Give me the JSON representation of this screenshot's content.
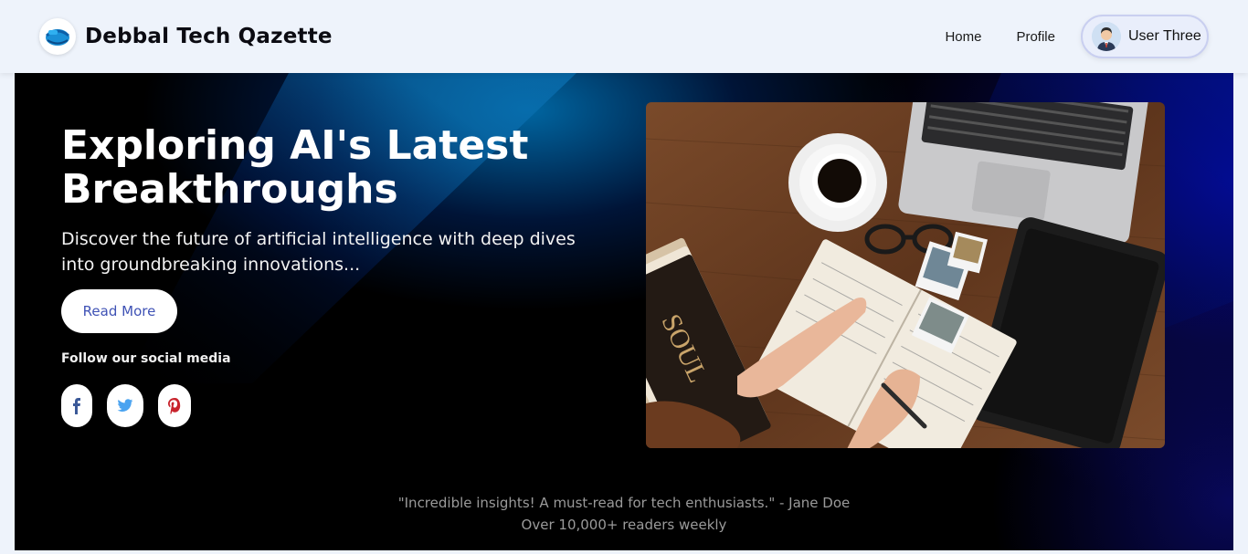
{
  "nav": {
    "brand": "Debbal Tech Qazette",
    "links": [
      {
        "label": "Home"
      },
      {
        "label": "Profile"
      }
    ],
    "user": {
      "name": "User Three"
    },
    "icons": {
      "logo": "globe-logo-icon",
      "avatar": "user-avatar-icon"
    }
  },
  "hero": {
    "title": "Exploring AI's Latest Breakthroughs",
    "subtitle": "Discover the future of artificial intelligence with deep dives into groundbreaking innovations...",
    "cta": "Read More",
    "follow_label": "Follow our social media",
    "socials": [
      {
        "icon": "facebook-icon",
        "color": "#3b5998"
      },
      {
        "icon": "twitter-icon",
        "color": "#4aa3f0"
      },
      {
        "icon": "pinterest-icon",
        "color": "#c8232c"
      }
    ],
    "photo": "desk-workspace-photo",
    "testimonial": "\"Incredible insights! A must-read for tech enthusiasts.\" - Jane Doe",
    "readers": "Over 10,000+ readers weekly"
  },
  "colors": {
    "accent": "#3f52b5",
    "hero_bg": "#000000",
    "hero_glow": "#0a0aa8"
  }
}
